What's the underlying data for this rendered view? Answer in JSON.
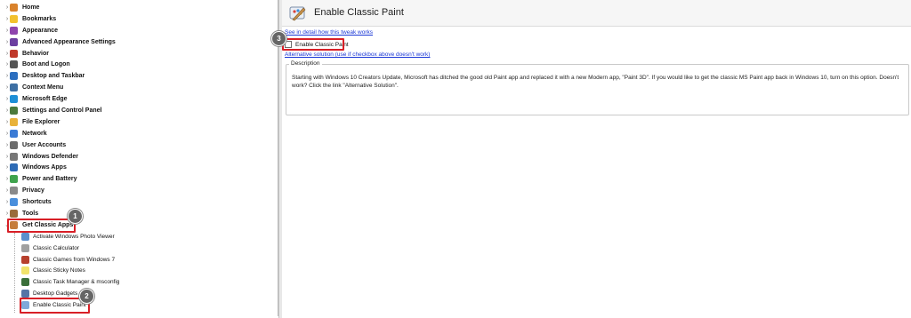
{
  "tree": {
    "items": [
      {
        "label": "Home",
        "icon": "home-icon",
        "color": "#d9822b",
        "expanded": false
      },
      {
        "label": "Bookmarks",
        "icon": "star-icon",
        "color": "#f2c12e",
        "expanded": false
      },
      {
        "label": "Appearance",
        "icon": "paint-palette-icon",
        "color": "#8e44ad",
        "expanded": false
      },
      {
        "label": "Advanced Appearance Settings",
        "icon": "palette-settings-icon",
        "color": "#6c3fa0",
        "expanded": false
      },
      {
        "label": "Behavior",
        "icon": "behavior-icon",
        "color": "#c0392b",
        "expanded": false
      },
      {
        "label": "Boot and Logon",
        "icon": "boot-icon",
        "color": "#555555",
        "expanded": false
      },
      {
        "label": "Desktop and Taskbar",
        "icon": "desktop-icon",
        "color": "#2c6fbf",
        "expanded": false
      },
      {
        "label": "Context Menu",
        "icon": "context-menu-icon",
        "color": "#3d6fa3",
        "expanded": false
      },
      {
        "label": "Microsoft Edge",
        "icon": "edge-icon",
        "color": "#1e8fd6",
        "expanded": false
      },
      {
        "label": "Settings and Control Panel",
        "icon": "control-panel-icon",
        "color": "#4b7a3c",
        "expanded": false
      },
      {
        "label": "File Explorer",
        "icon": "folder-icon",
        "color": "#e8b23a",
        "expanded": false
      },
      {
        "label": "Network",
        "icon": "network-icon",
        "color": "#3a7bd5",
        "expanded": false
      },
      {
        "label": "User Accounts",
        "icon": "user-accounts-icon",
        "color": "#6b6b6b",
        "expanded": false
      },
      {
        "label": "Windows Defender",
        "icon": "defender-icon",
        "color": "#777777",
        "expanded": false
      },
      {
        "label": "Windows Apps",
        "icon": "windows-apps-icon",
        "color": "#2d6bb5",
        "expanded": false
      },
      {
        "label": "Power and Battery",
        "icon": "power-icon",
        "color": "#3fa34d",
        "expanded": false
      },
      {
        "label": "Privacy",
        "icon": "privacy-icon",
        "color": "#8a8a8a",
        "expanded": false
      },
      {
        "label": "Shortcuts",
        "icon": "shortcut-icon",
        "color": "#4a8fdc",
        "expanded": false
      },
      {
        "label": "Tools",
        "icon": "tools-icon",
        "color": "#9a6b3a",
        "expanded": false
      },
      {
        "label": "Get Classic Apps",
        "icon": "classic-apps-icon",
        "color": "#c57c3c",
        "expanded": true
      }
    ],
    "children": [
      {
        "label": "Activate Windows Photo Viewer",
        "icon": "photo-viewer-icon",
        "color": "#5b8fcc"
      },
      {
        "label": "Classic Calculator",
        "icon": "calculator-icon",
        "color": "#a0a0a0"
      },
      {
        "label": "Classic Games from Windows 7",
        "icon": "games-icon",
        "color": "#b7402d"
      },
      {
        "label": "Classic Sticky Notes",
        "icon": "sticky-notes-icon",
        "color": "#f1e36b"
      },
      {
        "label": "Classic Task Manager & msconfig",
        "icon": "task-manager-icon",
        "color": "#3a6f3a"
      },
      {
        "label": "Desktop Gadgets",
        "icon": "gadgets-icon",
        "color": "#5574a6"
      },
      {
        "label": "Enable Classic Paint",
        "icon": "paint-icon",
        "color": "#7fa9d9"
      }
    ]
  },
  "markers": {
    "one": "1",
    "two": "2",
    "three": "3"
  },
  "main": {
    "title": "Enable Classic Paint",
    "learn_link": "See in detail how this tweak works",
    "checkbox_label": "Enable Classic Paint",
    "alt_link": "Alternative solution (use if checkbox above doesn't work)",
    "description_legend": "Description",
    "description_text": "Starting with Windows 10 Creators Update, Microsoft has ditched the good old Paint app and replaced it with a new Modern app, \"Paint 3D\". If you would like to get the classic MS Paint app back in Windows 10, turn on this option. Doesn't work? Click the link \"Alternative Solution\"."
  },
  "colors": {
    "highlight": "#d81f26",
    "link": "#1a37d6"
  }
}
